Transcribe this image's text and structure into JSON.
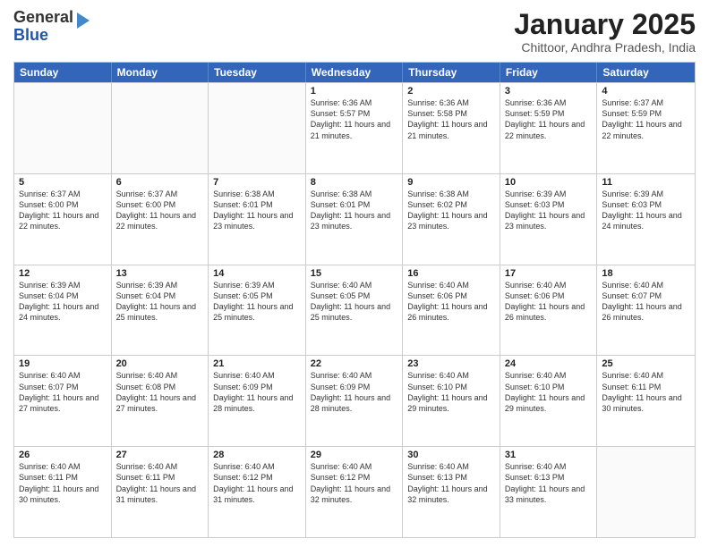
{
  "logo": {
    "general": "General",
    "blue": "Blue"
  },
  "header": {
    "month": "January 2025",
    "location": "Chittoor, Andhra Pradesh, India"
  },
  "days": [
    "Sunday",
    "Monday",
    "Tuesday",
    "Wednesday",
    "Thursday",
    "Friday",
    "Saturday"
  ],
  "weeks": [
    [
      {
        "day": "",
        "sunrise": "",
        "sunset": "",
        "daylight": ""
      },
      {
        "day": "",
        "sunrise": "",
        "sunset": "",
        "daylight": ""
      },
      {
        "day": "",
        "sunrise": "",
        "sunset": "",
        "daylight": ""
      },
      {
        "day": "1",
        "sunrise": "Sunrise: 6:36 AM",
        "sunset": "Sunset: 5:57 PM",
        "daylight": "Daylight: 11 hours and 21 minutes."
      },
      {
        "day": "2",
        "sunrise": "Sunrise: 6:36 AM",
        "sunset": "Sunset: 5:58 PM",
        "daylight": "Daylight: 11 hours and 21 minutes."
      },
      {
        "day": "3",
        "sunrise": "Sunrise: 6:36 AM",
        "sunset": "Sunset: 5:59 PM",
        "daylight": "Daylight: 11 hours and 22 minutes."
      },
      {
        "day": "4",
        "sunrise": "Sunrise: 6:37 AM",
        "sunset": "Sunset: 5:59 PM",
        "daylight": "Daylight: 11 hours and 22 minutes."
      }
    ],
    [
      {
        "day": "5",
        "sunrise": "Sunrise: 6:37 AM",
        "sunset": "Sunset: 6:00 PM",
        "daylight": "Daylight: 11 hours and 22 minutes."
      },
      {
        "day": "6",
        "sunrise": "Sunrise: 6:37 AM",
        "sunset": "Sunset: 6:00 PM",
        "daylight": "Daylight: 11 hours and 22 minutes."
      },
      {
        "day": "7",
        "sunrise": "Sunrise: 6:38 AM",
        "sunset": "Sunset: 6:01 PM",
        "daylight": "Daylight: 11 hours and 23 minutes."
      },
      {
        "day": "8",
        "sunrise": "Sunrise: 6:38 AM",
        "sunset": "Sunset: 6:01 PM",
        "daylight": "Daylight: 11 hours and 23 minutes."
      },
      {
        "day": "9",
        "sunrise": "Sunrise: 6:38 AM",
        "sunset": "Sunset: 6:02 PM",
        "daylight": "Daylight: 11 hours and 23 minutes."
      },
      {
        "day": "10",
        "sunrise": "Sunrise: 6:39 AM",
        "sunset": "Sunset: 6:03 PM",
        "daylight": "Daylight: 11 hours and 23 minutes."
      },
      {
        "day": "11",
        "sunrise": "Sunrise: 6:39 AM",
        "sunset": "Sunset: 6:03 PM",
        "daylight": "Daylight: 11 hours and 24 minutes."
      }
    ],
    [
      {
        "day": "12",
        "sunrise": "Sunrise: 6:39 AM",
        "sunset": "Sunset: 6:04 PM",
        "daylight": "Daylight: 11 hours and 24 minutes."
      },
      {
        "day": "13",
        "sunrise": "Sunrise: 6:39 AM",
        "sunset": "Sunset: 6:04 PM",
        "daylight": "Daylight: 11 hours and 25 minutes."
      },
      {
        "day": "14",
        "sunrise": "Sunrise: 6:39 AM",
        "sunset": "Sunset: 6:05 PM",
        "daylight": "Daylight: 11 hours and 25 minutes."
      },
      {
        "day": "15",
        "sunrise": "Sunrise: 6:40 AM",
        "sunset": "Sunset: 6:05 PM",
        "daylight": "Daylight: 11 hours and 25 minutes."
      },
      {
        "day": "16",
        "sunrise": "Sunrise: 6:40 AM",
        "sunset": "Sunset: 6:06 PM",
        "daylight": "Daylight: 11 hours and 26 minutes."
      },
      {
        "day": "17",
        "sunrise": "Sunrise: 6:40 AM",
        "sunset": "Sunset: 6:06 PM",
        "daylight": "Daylight: 11 hours and 26 minutes."
      },
      {
        "day": "18",
        "sunrise": "Sunrise: 6:40 AM",
        "sunset": "Sunset: 6:07 PM",
        "daylight": "Daylight: 11 hours and 26 minutes."
      }
    ],
    [
      {
        "day": "19",
        "sunrise": "Sunrise: 6:40 AM",
        "sunset": "Sunset: 6:07 PM",
        "daylight": "Daylight: 11 hours and 27 minutes."
      },
      {
        "day": "20",
        "sunrise": "Sunrise: 6:40 AM",
        "sunset": "Sunset: 6:08 PM",
        "daylight": "Daylight: 11 hours and 27 minutes."
      },
      {
        "day": "21",
        "sunrise": "Sunrise: 6:40 AM",
        "sunset": "Sunset: 6:09 PM",
        "daylight": "Daylight: 11 hours and 28 minutes."
      },
      {
        "day": "22",
        "sunrise": "Sunrise: 6:40 AM",
        "sunset": "Sunset: 6:09 PM",
        "daylight": "Daylight: 11 hours and 28 minutes."
      },
      {
        "day": "23",
        "sunrise": "Sunrise: 6:40 AM",
        "sunset": "Sunset: 6:10 PM",
        "daylight": "Daylight: 11 hours and 29 minutes."
      },
      {
        "day": "24",
        "sunrise": "Sunrise: 6:40 AM",
        "sunset": "Sunset: 6:10 PM",
        "daylight": "Daylight: 11 hours and 29 minutes."
      },
      {
        "day": "25",
        "sunrise": "Sunrise: 6:40 AM",
        "sunset": "Sunset: 6:11 PM",
        "daylight": "Daylight: 11 hours and 30 minutes."
      }
    ],
    [
      {
        "day": "26",
        "sunrise": "Sunrise: 6:40 AM",
        "sunset": "Sunset: 6:11 PM",
        "daylight": "Daylight: 11 hours and 30 minutes."
      },
      {
        "day": "27",
        "sunrise": "Sunrise: 6:40 AM",
        "sunset": "Sunset: 6:11 PM",
        "daylight": "Daylight: 11 hours and 31 minutes."
      },
      {
        "day": "28",
        "sunrise": "Sunrise: 6:40 AM",
        "sunset": "Sunset: 6:12 PM",
        "daylight": "Daylight: 11 hours and 31 minutes."
      },
      {
        "day": "29",
        "sunrise": "Sunrise: 6:40 AM",
        "sunset": "Sunset: 6:12 PM",
        "daylight": "Daylight: 11 hours and 32 minutes."
      },
      {
        "day": "30",
        "sunrise": "Sunrise: 6:40 AM",
        "sunset": "Sunset: 6:13 PM",
        "daylight": "Daylight: 11 hours and 32 minutes."
      },
      {
        "day": "31",
        "sunrise": "Sunrise: 6:40 AM",
        "sunset": "Sunset: 6:13 PM",
        "daylight": "Daylight: 11 hours and 33 minutes."
      },
      {
        "day": "",
        "sunrise": "",
        "sunset": "",
        "daylight": ""
      }
    ]
  ]
}
